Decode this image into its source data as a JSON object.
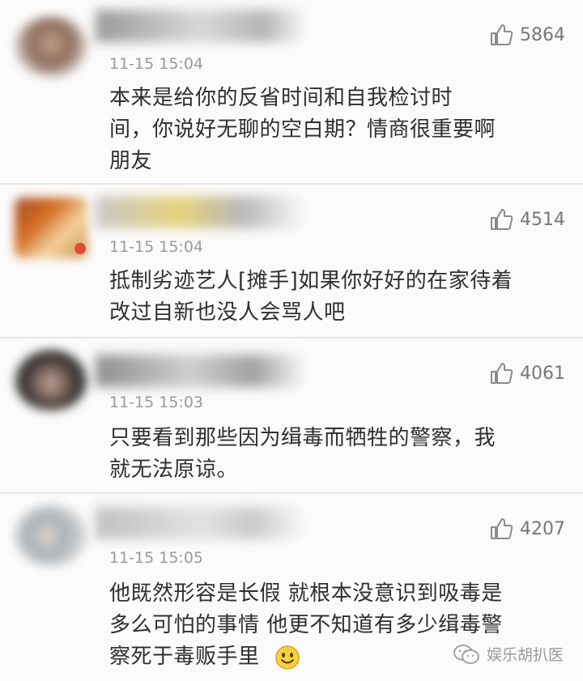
{
  "comments": [
    {
      "time": "11-15 15:04",
      "likes": "5864",
      "text": "本来是给你的反省时间和自我检讨时间，你说好无聊的空白期？情商很重要啊朋友",
      "lines": [
        "本来是给你的反省时间和自我检讨时",
        "间，你说好无聊的空白期？情商很重要啊",
        "朋友"
      ]
    },
    {
      "time": "11-15 15:04",
      "likes": "4514",
      "lines": [
        "抵制劣迹艺人[摊手]如果你好好的在家待着",
        "改过自新也没人会骂人吧"
      ]
    },
    {
      "time": "11-15 15:03",
      "likes": "4061",
      "lines": [
        "只要看到那些因为缉毒而牺牲的警察，我",
        "就无法原谅。"
      ]
    },
    {
      "time": "11-15 15:05",
      "likes": "4207",
      "lines": [
        "他既然形容是长假 就根本没意识到吸毒是",
        "多么可怕的事情 他更不知道有多少缉毒警",
        "察死于毒贩手里"
      ]
    }
  ],
  "icons": {
    "like": "thumbs-up-icon",
    "emoji": "smiley-icon",
    "watermark": "wechat-icon"
  },
  "watermark": {
    "text": "娱乐胡扒医"
  },
  "colors": {
    "background": "#fbfbfb",
    "divider": "#e6e6e6",
    "text": "#2f2f2f",
    "meta": "#9a9a9a"
  }
}
